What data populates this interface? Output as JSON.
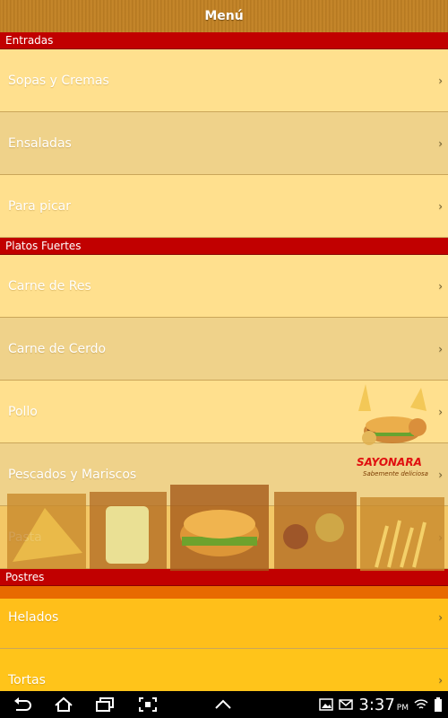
{
  "app": {
    "title": "Menú"
  },
  "menu": {
    "entradas": {
      "header": "Entradas",
      "items": [
        "Sopas y Cremas",
        "Ensaladas",
        "Para picar"
      ]
    },
    "platos": {
      "header": "Platos Fuertes",
      "items": [
        "Carne de Res",
        "Carne de Cerdo",
        "Pollo",
        "Pescados y Mariscos",
        "Pasta"
      ]
    },
    "postres": {
      "header": "Postres",
      "items": [
        "Helados",
        "Tortas"
      ]
    }
  },
  "branding": {
    "logo": "SAYONARA",
    "tagline": "Sabemente deliciosa"
  },
  "status_bar": {
    "time": "3:37",
    "ampm": "PM"
  },
  "icons": {
    "chevron": "chevron-right-icon",
    "back": "back-icon",
    "home": "home-icon",
    "recents": "recent-apps-icon",
    "screenshot": "screenshot-icon",
    "up": "chevron-up-icon",
    "gallery": "gallery-icon",
    "mail": "mail-icon",
    "wifi": "wifi-icon",
    "battery": "battery-icon"
  },
  "colors": {
    "section": "#c10000",
    "row_light": "#ffe08e",
    "row_dark": "#efd28a",
    "accent": "#ffbf00"
  }
}
